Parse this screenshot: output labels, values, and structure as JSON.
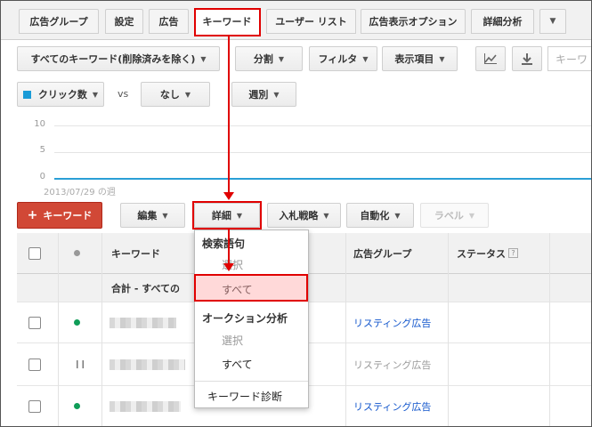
{
  "tabs": [
    {
      "label": "広告グループ",
      "active": false
    },
    {
      "label": "設定",
      "active": false
    },
    {
      "label": "広告",
      "active": false
    },
    {
      "label": "キーワード",
      "active": true
    },
    {
      "label": "ユーザー リスト",
      "active": false
    },
    {
      "label": "広告表示オプション",
      "active": false
    },
    {
      "label": "詳細分析",
      "active": false
    }
  ],
  "toolbar": {
    "filter_select": "すべてのキーワード(削除済みを除く)",
    "segment": "分割",
    "filter": "フィルタ",
    "columns": "表示項目",
    "search_placeholder": "キーワ"
  },
  "chart_controls": {
    "metric1": "クリック数",
    "metric1_color": "#1a9bd7",
    "vs": "vs",
    "metric2": "なし",
    "period": "週別"
  },
  "chart_data": {
    "type": "line",
    "y_ticks": [
      "10",
      "5",
      "0"
    ],
    "ylim": [
      0,
      10
    ],
    "x_label": "2013/07/29 の週",
    "series": [
      {
        "values": [
          0,
          0
        ]
      }
    ]
  },
  "actions": {
    "add_keyword": "キーワード",
    "edit": "編集",
    "details": "詳細",
    "bid_strategy": "入札戦略",
    "automate": "自動化",
    "labels": "ラベル"
  },
  "table": {
    "headers": {
      "keyword": "キーワード",
      "ad_group": "広告グループ",
      "status": "ステータス"
    },
    "total_label": "合計 - すべての",
    "rows": [
      {
        "status": "active",
        "ad_group": "リスティング広告",
        "muted": false
      },
      {
        "status": "paused",
        "ad_group": "リスティング広告",
        "muted": true
      },
      {
        "status": "active",
        "ad_group": "リスティング広告",
        "muted": false
      }
    ]
  },
  "details_menu": {
    "search_terms": "検索語句",
    "search_select": "選択",
    "search_all": "すべて",
    "auction_insights": "オークション分析",
    "auction_select": "選択",
    "auction_all": "すべて",
    "keyword_diagnosis": "キーワード診断"
  }
}
